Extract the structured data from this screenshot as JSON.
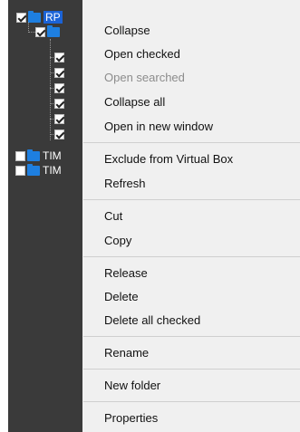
{
  "tree": {
    "root": {
      "label": "RP",
      "checked": true
    },
    "child": {
      "checked": true
    },
    "leaf_count": 6,
    "others": [
      {
        "label": "TIM",
        "checked": false
      },
      {
        "label": "TIM",
        "checked": false
      }
    ]
  },
  "context_menu": {
    "items": [
      {
        "label": "Collapse",
        "enabled": true
      },
      {
        "label": "Open checked",
        "enabled": true
      },
      {
        "label": "Open searched",
        "enabled": false
      },
      {
        "label": "Collapse all",
        "enabled": true
      },
      {
        "label": "Open in new window",
        "enabled": true
      },
      {
        "label": "Exclude from Virtual Box",
        "enabled": true
      },
      {
        "label": "Refresh",
        "enabled": true
      },
      {
        "label": "Cut",
        "enabled": true
      },
      {
        "label": "Copy",
        "enabled": true
      },
      {
        "label": "Release",
        "enabled": true
      },
      {
        "label": "Delete",
        "enabled": true
      },
      {
        "label": "Delete all checked",
        "enabled": true
      },
      {
        "label": "Rename",
        "enabled": true
      },
      {
        "label": "New folder",
        "enabled": true
      },
      {
        "label": "Properties",
        "enabled": true
      }
    ]
  },
  "colors": {
    "selection": "#1b63d6",
    "folder": "#1e7fe0",
    "panel": "#3a3a3a",
    "menu_bg": "#f0f0f0",
    "disabled_text": "#8c8c8c"
  }
}
